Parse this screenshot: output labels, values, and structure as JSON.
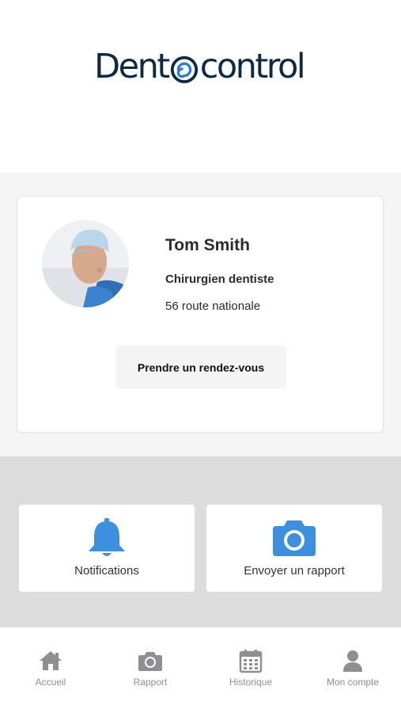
{
  "header": {
    "logo_text_left": "Dent",
    "logo_text_right": "control"
  },
  "profile": {
    "name": "Tom Smith",
    "title": "Chirurgien dentiste",
    "address": "56 route nationale",
    "appointment_button": "Prendre un rendez-vous"
  },
  "actions": [
    {
      "label": "Notifications",
      "icon": "bell-icon"
    },
    {
      "label": "Envoyer un rapport",
      "icon": "camera-icon"
    }
  ],
  "tabs": [
    {
      "label": "Accueil",
      "icon": "home-icon"
    },
    {
      "label": "Rapport",
      "icon": "camera-icon"
    },
    {
      "label": "Historique",
      "icon": "calendar-icon"
    },
    {
      "label": "Mon compte",
      "icon": "user-icon"
    }
  ],
  "colors": {
    "accent": "#3d8fe0",
    "logo_dark": "#0d2a45",
    "tab_gray": "#8e8e93"
  }
}
